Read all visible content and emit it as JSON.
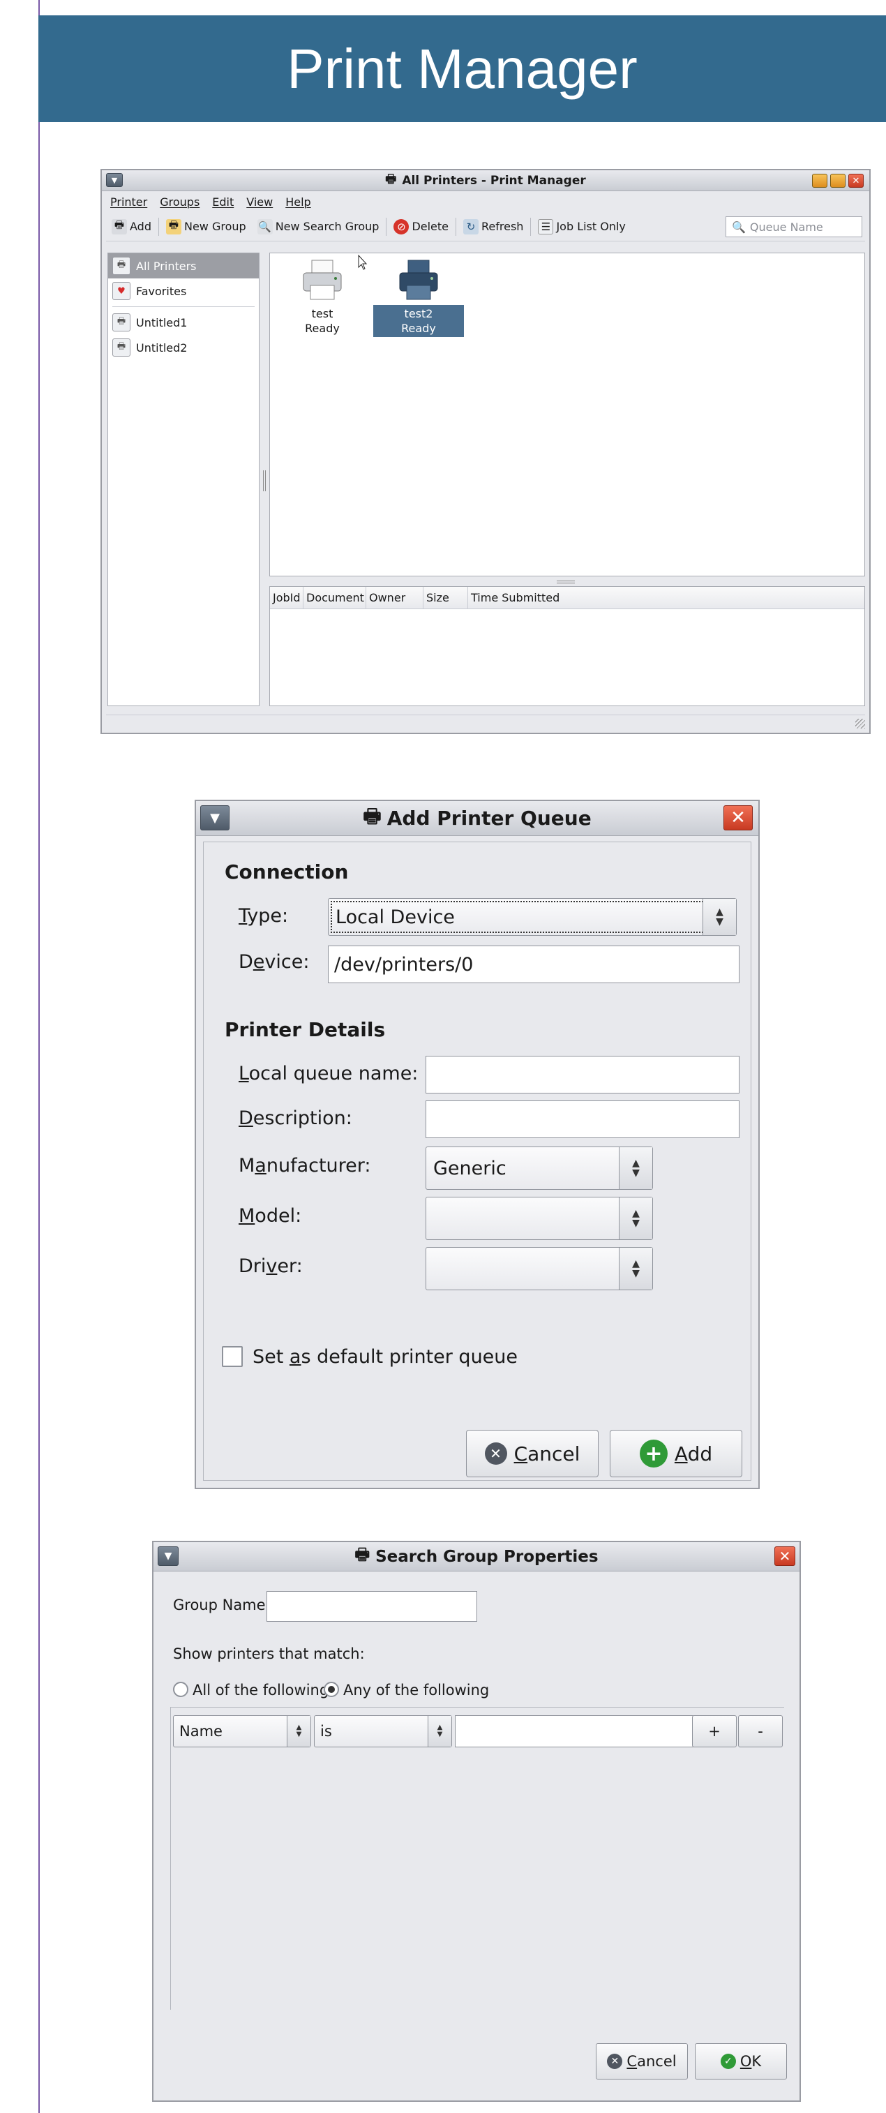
{
  "header": {
    "title": "Print Manager"
  },
  "print_manager": {
    "window_title": "All Printers - Print Manager",
    "menus": [
      "Printer",
      "Groups",
      "Edit",
      "View",
      "Help"
    ],
    "toolbar": {
      "add": "Add",
      "new_group": "New Group",
      "new_search_group": "New Search Group",
      "delete": "Delete",
      "refresh": "Refresh",
      "job_list_only": "Job List Only",
      "search_placeholder": "Queue Name"
    },
    "sidebar": {
      "items": [
        "All Printers",
        "Favorites",
        "Untitled1",
        "Untitled2"
      ]
    },
    "printers": [
      {
        "name": "test",
        "status": "Ready"
      },
      {
        "name": "test2",
        "status": "Ready"
      }
    ],
    "job_columns": [
      "JobId",
      "Document",
      "Owner",
      "Size",
      "Time Submitted"
    ]
  },
  "add_printer": {
    "title": "Add Printer Queue",
    "connection_heading": "Connection",
    "type_label_pre": "",
    "type_label_u": "T",
    "type_label_post": "ype:",
    "type_value": "Local Device",
    "device_label_pre": "D",
    "device_label_u": "e",
    "device_label_post": "vice:",
    "device_value": "/dev/printers/0",
    "details_heading": "Printer Details",
    "local_queue_u": "L",
    "local_queue_post": "ocal queue name:",
    "description_u": "D",
    "description_post": "escription:",
    "manufacturer_pre": "M",
    "manufacturer_u": "a",
    "manufacturer_post": "nufacturer:",
    "manufacturer_value": "Generic",
    "model_u": "M",
    "model_post": "odel:",
    "driver_pre": "Dri",
    "driver_u": "v",
    "driver_post": "er:",
    "default_pre": "Set ",
    "default_u": "a",
    "default_post": "s default printer queue",
    "cancel_u": "C",
    "cancel_post": "ancel",
    "add_u": "A",
    "add_post": "dd"
  },
  "search_group": {
    "title": "Search Group Properties",
    "group_name_label": "Group Name:",
    "show_label": "Show printers that match:",
    "all_label": "All of the following",
    "any_label": "Any of the following",
    "field_value": "Name",
    "op_value": "is",
    "plus": "+",
    "minus": "-",
    "cancel_u": "C",
    "cancel_post": "ancel",
    "ok_u": "O",
    "ok_post": "K"
  },
  "colors": {
    "header_bg": "#336a8e",
    "selection": "#4a6f90",
    "close": "#c83a22"
  },
  "icons": [
    "printer-icon",
    "menu-icon",
    "close-icon",
    "search-icon",
    "add-icon",
    "delete-icon",
    "refresh-icon",
    "heart-icon",
    "cancel-icon",
    "ok-icon"
  ]
}
